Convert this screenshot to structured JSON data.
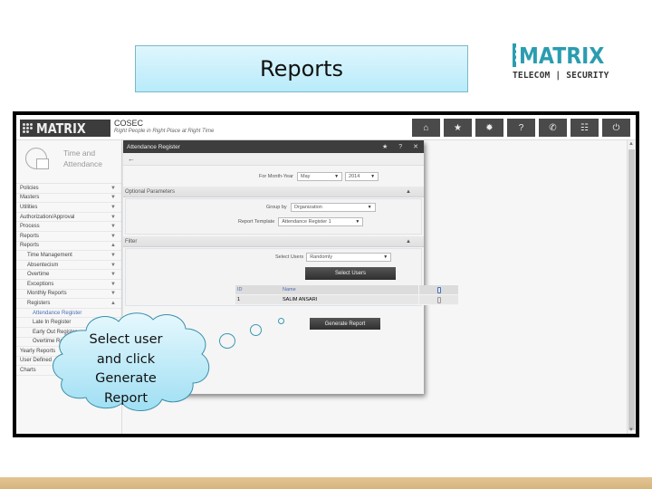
{
  "slide": {
    "title": "Reports",
    "brand": {
      "name": "MATRIX",
      "tagline": "TELECOM | SECURITY"
    },
    "callout": {
      "lines": [
        "Select user",
        "and click",
        "Generate",
        "Report"
      ]
    },
    "colors": {
      "title_bg": "#c6effb",
      "brand": "#2a9db0",
      "footer": "#d9b985"
    }
  },
  "app": {
    "logo": "MATRIX",
    "product": "COSEC",
    "tagline": "Right People in Right Place at Right Time",
    "toolbar": [
      {
        "name": "home-icon",
        "glyph": "⌂"
      },
      {
        "name": "star-icon",
        "glyph": "★"
      },
      {
        "name": "gear-icon",
        "glyph": "✹"
      },
      {
        "name": "help-icon",
        "glyph": "?"
      },
      {
        "name": "phone-icon",
        "glyph": "✆"
      },
      {
        "name": "modules-icon",
        "glyph": "☷"
      },
      {
        "name": "power-icon",
        "glyph": "⏻"
      }
    ],
    "module": {
      "line1": "Time and",
      "line2": "Attendance"
    },
    "sidebar": [
      {
        "label": "Policies",
        "level": 0,
        "chev": "▼"
      },
      {
        "label": "Masters",
        "level": 0,
        "chev": "▼"
      },
      {
        "label": "Utilities",
        "level": 0,
        "chev": "▼"
      },
      {
        "label": "Authorization/Approval",
        "level": 0,
        "chev": "▼"
      },
      {
        "label": "Process",
        "level": 0,
        "chev": "▼"
      },
      {
        "label": "Reports",
        "level": 0,
        "chev": "▼"
      },
      {
        "label": "Reports",
        "level": 0,
        "chev": "▲"
      },
      {
        "label": "Time Management",
        "level": 1,
        "chev": "▼"
      },
      {
        "label": "Absentecism",
        "level": 1,
        "chev": "▼"
      },
      {
        "label": "Overtime",
        "level": 1,
        "chev": "▼"
      },
      {
        "label": "Exceptions",
        "level": 1,
        "chev": "▼"
      },
      {
        "label": "Monthly Reports",
        "level": 1,
        "chev": "▼"
      },
      {
        "label": "Registers",
        "level": 1,
        "chev": "▲"
      },
      {
        "label": "Attendance Register",
        "level": 2,
        "chev": "",
        "active": true
      },
      {
        "label": "Late In Register",
        "level": 2,
        "chev": ""
      },
      {
        "label": "Early Out Register",
        "level": 2,
        "chev": ""
      },
      {
        "label": "Overtime Register",
        "level": 2,
        "chev": ""
      },
      {
        "label": "Yearly Reports",
        "level": 0,
        "chev": ""
      },
      {
        "label": "User Defined",
        "level": 0,
        "chev": ""
      },
      {
        "label": "Charts",
        "level": 0,
        "chev": ""
      }
    ],
    "dialog": {
      "title": "Attendance Register",
      "controls": {
        "fav": "★",
        "help": "?",
        "close": "✕"
      },
      "back": "←",
      "month_year_label": "For Month-Year",
      "month": "May",
      "year": "2014",
      "optional_header": "Optional Parameters",
      "group_by_label": "Group by",
      "group_by": "Organization",
      "template_label": "Report Template",
      "template": "Attendance Register 1",
      "filter_header": "Filter",
      "select_users_label": "Select Users",
      "select_users_value": "Randomly",
      "select_users_button": "Select Users",
      "table": {
        "headers": {
          "id": "ID",
          "name": "Name"
        },
        "rows": [
          {
            "id": "1",
            "name": "SALIM ANSARI"
          }
        ]
      },
      "generate_button": "Generate Report"
    }
  }
}
